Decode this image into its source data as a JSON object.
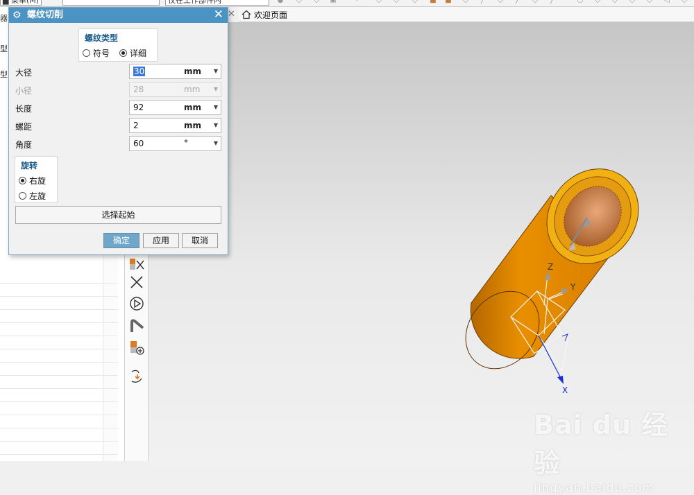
{
  "toolbar": {
    "combo1_value": "█ 菜单(M)",
    "combo2_value": "",
    "combo3_value": "仅在工作部件内"
  },
  "navigator": {
    "partial_labels": [
      "器",
      "型",
      "型"
    ]
  },
  "tab": {
    "label": "欢迎页面"
  },
  "dialog": {
    "title": "螺纹切削",
    "thread_type": {
      "title": "螺纹类型",
      "options": [
        {
          "label": "符号",
          "selected": false
        },
        {
          "label": "详细",
          "selected": true
        }
      ]
    },
    "params": [
      {
        "label": "大径",
        "value": "30",
        "unit": "mm",
        "enabled": true,
        "selected_text": true
      },
      {
        "label": "小径",
        "value": "28",
        "unit": "mm",
        "enabled": false,
        "selected_text": false
      },
      {
        "label": "长度",
        "value": "92",
        "unit": "mm",
        "enabled": true,
        "selected_text": false
      },
      {
        "label": "螺距",
        "value": "2",
        "unit": "mm",
        "enabled": true,
        "selected_text": false
      },
      {
        "label": "角度",
        "value": "60",
        "unit": "°",
        "enabled": true,
        "selected_text": false
      }
    ],
    "rotation": {
      "title": "旋转",
      "options": [
        {
          "label": "右旋",
          "selected": true
        },
        {
          "label": "左旋",
          "selected": false
        }
      ]
    },
    "select_start_label": "选择起始",
    "buttons": {
      "ok": "确定",
      "apply": "应用",
      "cancel": "取消"
    }
  },
  "viewport": {
    "axes": {
      "x": "X",
      "y": "Y",
      "z": "Z"
    },
    "colors": {
      "body": "#e08a00",
      "body_dark": "#b86a00",
      "end_face": "#f3b413",
      "bore": "#c77d3d",
      "axis_x": "#1a2fd6",
      "axis_triad": "#ffffff"
    }
  },
  "watermark": {
    "brand": "Bai du 经验",
    "url": "jingyan.baidu.com"
  }
}
